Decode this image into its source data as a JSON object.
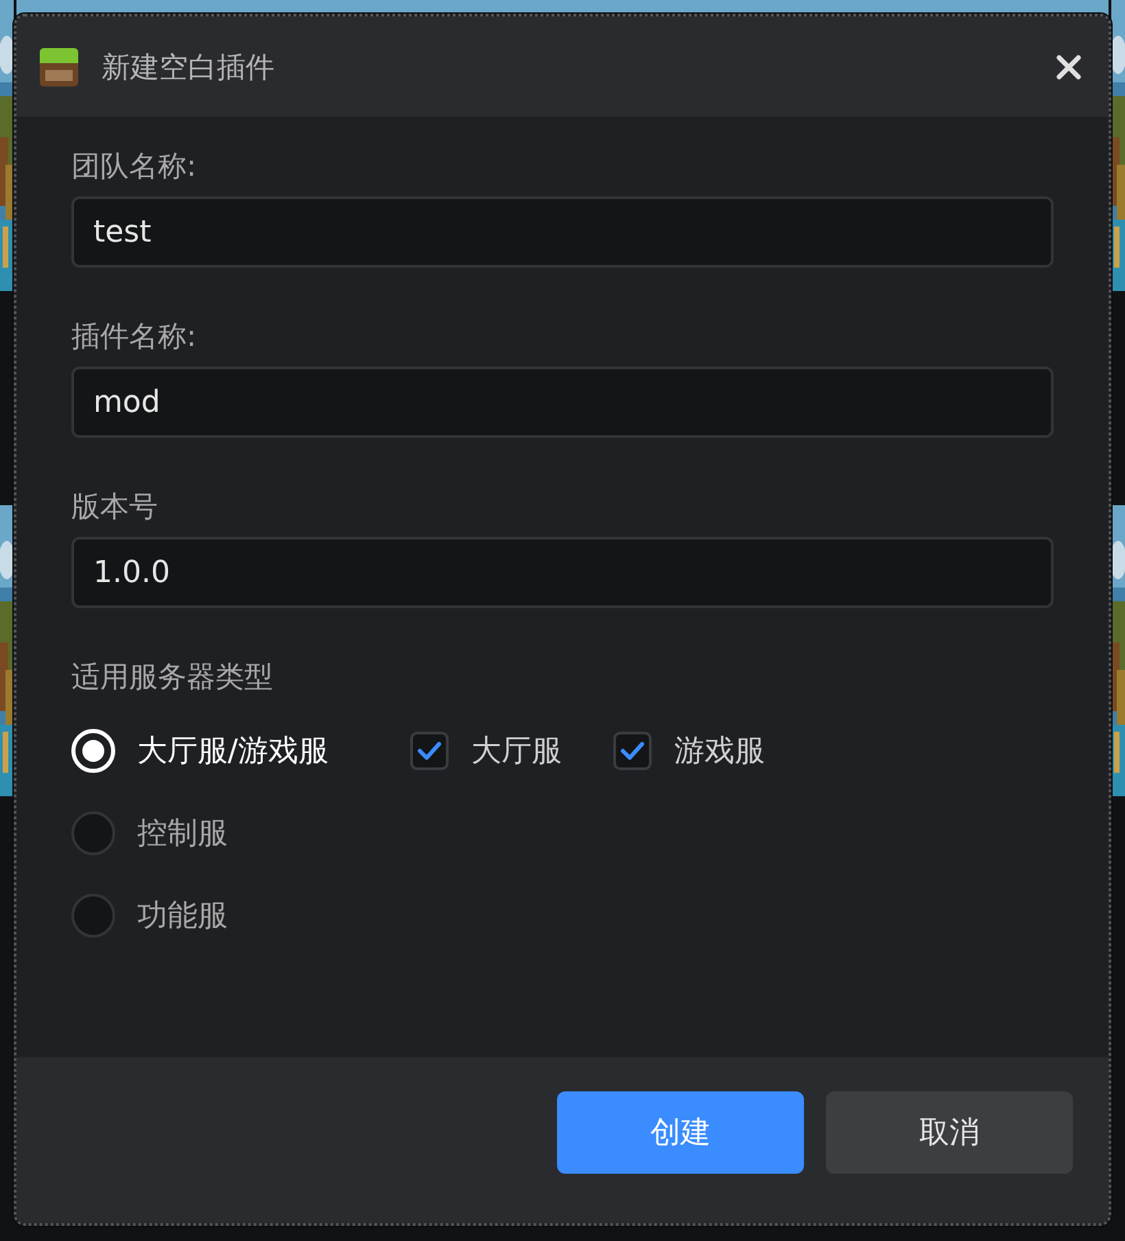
{
  "window": {
    "title": "新建空白插件"
  },
  "fields": [
    {
      "label": "团队名称:",
      "value": "test"
    },
    {
      "label": "插件名称:",
      "value": "mod"
    },
    {
      "label": "版本号",
      "value": "1.0.0"
    }
  ],
  "server_type": {
    "label": "适用服务器类型",
    "options": [
      {
        "label": "大厅服/游戏服",
        "selected": true,
        "sub_options": [
          {
            "label": "大厅服",
            "checked": true
          },
          {
            "label": "游戏服",
            "checked": true
          }
        ]
      },
      {
        "label": "控制服",
        "selected": false
      },
      {
        "label": "功能服",
        "selected": false
      }
    ]
  },
  "buttons": [
    {
      "label": "创建",
      "kind": "primary"
    },
    {
      "label": "取消",
      "kind": "secondary"
    }
  ]
}
